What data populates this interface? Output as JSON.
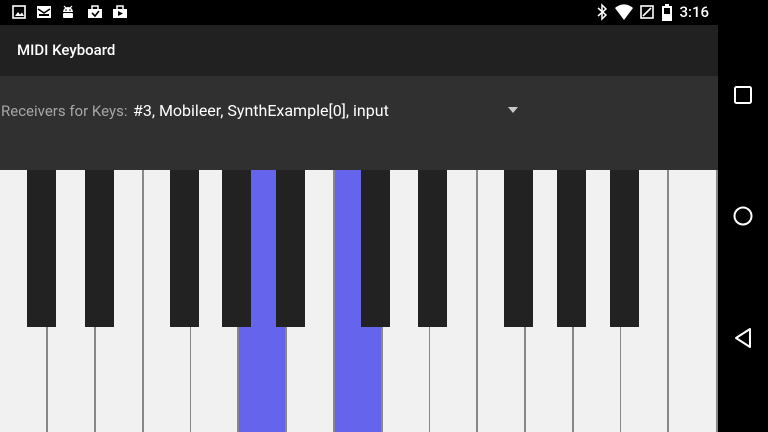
{
  "status_bar": {
    "notification_icons": [
      "image-icon",
      "mail-icon",
      "android-icon",
      "briefcase-icon",
      "briefcase-play-icon"
    ],
    "system_icons": [
      "bluetooth-icon",
      "wifi-icon",
      "battery-alert-icon",
      "battery-icon"
    ],
    "time": "3:16"
  },
  "app_bar": {
    "title": "MIDI Keyboard"
  },
  "receivers": {
    "label": "Receivers for Keys:",
    "selected": "#3, Mobileer, SynthExample[0], input"
  },
  "keyboard": {
    "white_key_count": 15,
    "pressed_white_keys": [
      5,
      7
    ],
    "black_key_count": 10,
    "pressed_color": "#6464ec"
  },
  "nav_bar": {
    "buttons": [
      "recents-button",
      "home-button",
      "back-button"
    ]
  }
}
